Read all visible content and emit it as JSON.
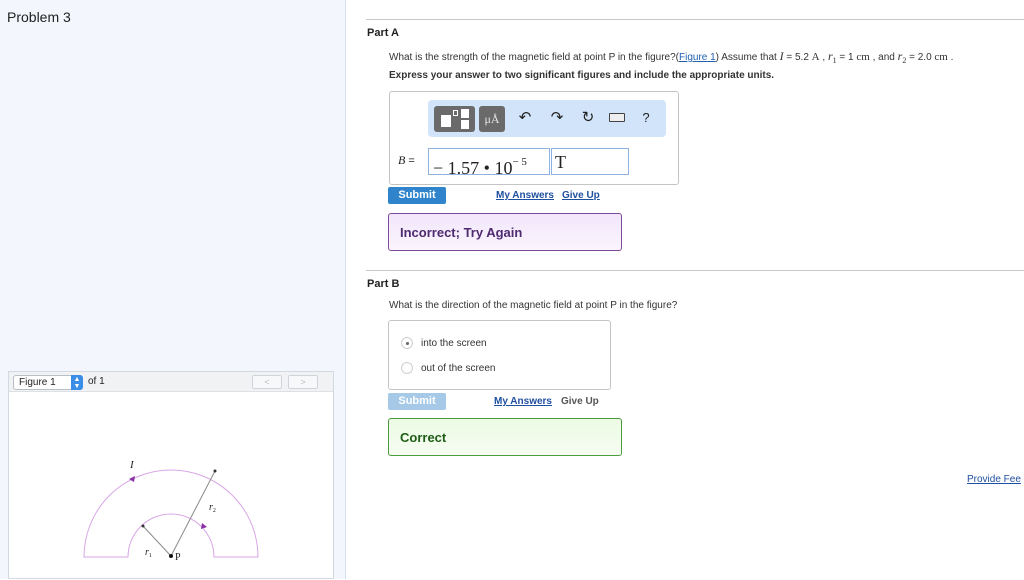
{
  "left_pane": {
    "problem_title": "Problem 3",
    "figure_nav": {
      "selected_figure": "Figure 1",
      "of_label": "of 1",
      "prev_icon": "chevron-left-icon",
      "next_icon": "chevron-right-icon"
    },
    "figure": {
      "labels": {
        "current": "I",
        "r1": "r",
        "r1_sub": "1",
        "r2": "r",
        "r2_sub": "2",
        "point": "P"
      },
      "colors": {
        "loop": "#d9a6e6",
        "arrow": "#8a2fa6",
        "radius_line": "#8a8a8a"
      }
    }
  },
  "part_a": {
    "title": "Part A",
    "question_prefix": "What is the strength of the magnetic field at point P in the figure?(",
    "figure_link": "Figure 1",
    "question_mid": ") Assume that ",
    "var_I": "I",
    "val_I": " = 5.2 ",
    "unit_I": "A",
    "sep1": " , ",
    "var_r1": "r",
    "sub_r1": "1",
    "val_r1": " = 1 ",
    "unit_r1": "cm",
    "sep2": " , and ",
    "var_r2": "r",
    "sub_r2": "2",
    "val_r2": " = 2.0 ",
    "unit_r2": "cm",
    "end": " .",
    "instruction": "Express your answer to two significant figures and include the appropriate units.",
    "toolbar": {
      "template_icon": "templates-icon",
      "units_label": "μÅ",
      "undo_icon": "undo-icon",
      "redo_icon": "redo-icon",
      "reset_icon": "reset-icon",
      "keyboard_icon": "keyboard-icon",
      "help_label": "?"
    },
    "answer_label": "B",
    "answer_eq": " =",
    "answer_value": "− 1.57 • 10",
    "answer_exponent": "− 5",
    "answer_unit": "T",
    "submit_label": "Submit",
    "my_answers_label": "My Answers",
    "give_up_label": "Give Up",
    "feedback": "Incorrect; Try Again"
  },
  "part_b": {
    "title": "Part B",
    "question": "What is the direction of the magnetic field at point P in the figure?",
    "options": [
      {
        "label": "into the screen",
        "selected": true
      },
      {
        "label": "out of the screen",
        "selected": false
      }
    ],
    "submit_label": "Submit",
    "my_answers_label": "My Answers",
    "give_up_label": "Give Up",
    "feedback": "Correct"
  },
  "provide_feedback": "Provide Fee"
}
